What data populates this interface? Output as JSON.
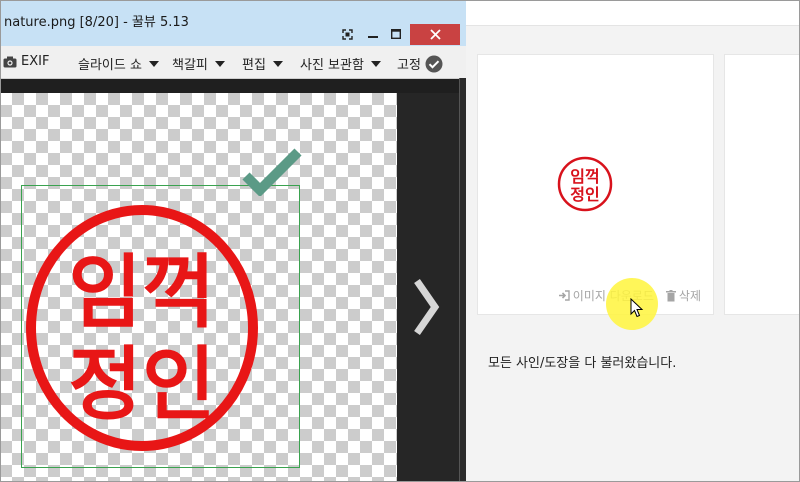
{
  "viewer": {
    "title": "nature.png [8/20] - 꿀뷰 5.13",
    "window_controls": {
      "fullscreen": "⛶",
      "minimize": "—",
      "maximize": "☐",
      "close": "✕"
    },
    "toolbar": {
      "exif": "EXIF",
      "slideshow": "슬라이드 쇼",
      "bookmark": "책갈피",
      "edit": "편집",
      "photo_storage": "사진 보관함",
      "pin": "고정"
    },
    "image": {
      "stamp_line1": "임꺽",
      "stamp_line2": "정인"
    }
  },
  "webpage": {
    "card": {
      "stamp_line1": "임꺽",
      "stamp_line2": "정인",
      "download_label": "이미지 다운로드",
      "delete_label": "삭제"
    },
    "status_message": "모든 사인/도장을 다 불러왔습니다."
  },
  "colors": {
    "stamp_red": "#e81616",
    "selection_green": "#3aa24f",
    "check_green": "#5b9a86",
    "title_bar": "#c7e1f5",
    "close_red": "#c94242",
    "cursor_highlight": "#fff53c"
  }
}
